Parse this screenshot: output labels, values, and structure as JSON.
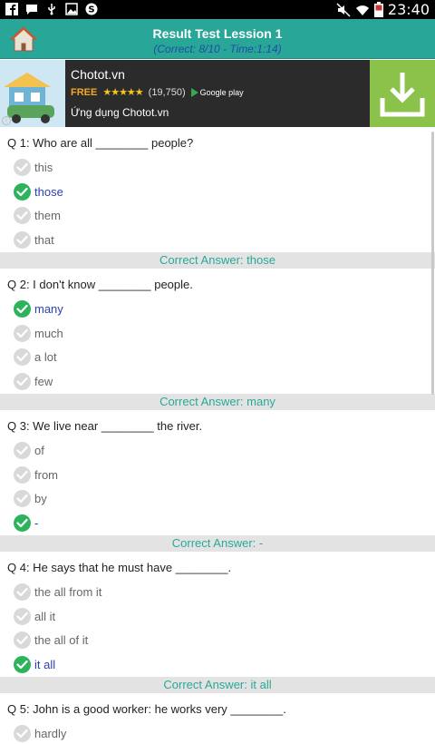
{
  "status_bar": {
    "time": "23:40"
  },
  "header": {
    "title": "Result Test Lession 1",
    "subtitle": "(Correct: 8/10 -  Time:1:14)"
  },
  "ad": {
    "name": "Chotot.vn",
    "free": "FREE",
    "stars": "★★★★★",
    "count": "(19,750)",
    "store": "Google play",
    "description": "Ứng dụng Chotot.vn"
  },
  "questions": [
    {
      "text": "Q 1: Who are all ________ people?",
      "options": [
        {
          "label": "this",
          "correct": false
        },
        {
          "label": "those",
          "correct": true
        },
        {
          "label": "them",
          "correct": false
        },
        {
          "label": " that",
          "correct": false
        }
      ],
      "answer": "Correct Answer: those"
    },
    {
      "text": "Q 2: I don't know ________ people.",
      "options": [
        {
          "label": "many",
          "correct": true
        },
        {
          "label": "much",
          "correct": false
        },
        {
          "label": "a lot",
          "correct": false
        },
        {
          "label": " few",
          "correct": false
        }
      ],
      "answer": "Correct Answer: many"
    },
    {
      "text": "Q 3: We live near ________ the river.",
      "options": [
        {
          "label": "of",
          "correct": false
        },
        {
          "label": "from",
          "correct": false
        },
        {
          "label": "by",
          "correct": false
        },
        {
          "label": "-",
          "correct": true
        }
      ],
      "answer": "Correct Answer: -"
    },
    {
      "text": "Q 4: He says that he must have ________.",
      "options": [
        {
          "label": "the all from it",
          "correct": false
        },
        {
          "label": "all it",
          "correct": false
        },
        {
          "label": "the all of it",
          "correct": false
        },
        {
          "label": " it all",
          "correct": true
        }
      ],
      "answer": "Correct Answer: it all"
    },
    {
      "text": "Q 5: John is a good worker: he works very ________.",
      "options": [
        {
          "label": "hardly",
          "correct": false
        }
      ],
      "answer": ""
    }
  ]
}
